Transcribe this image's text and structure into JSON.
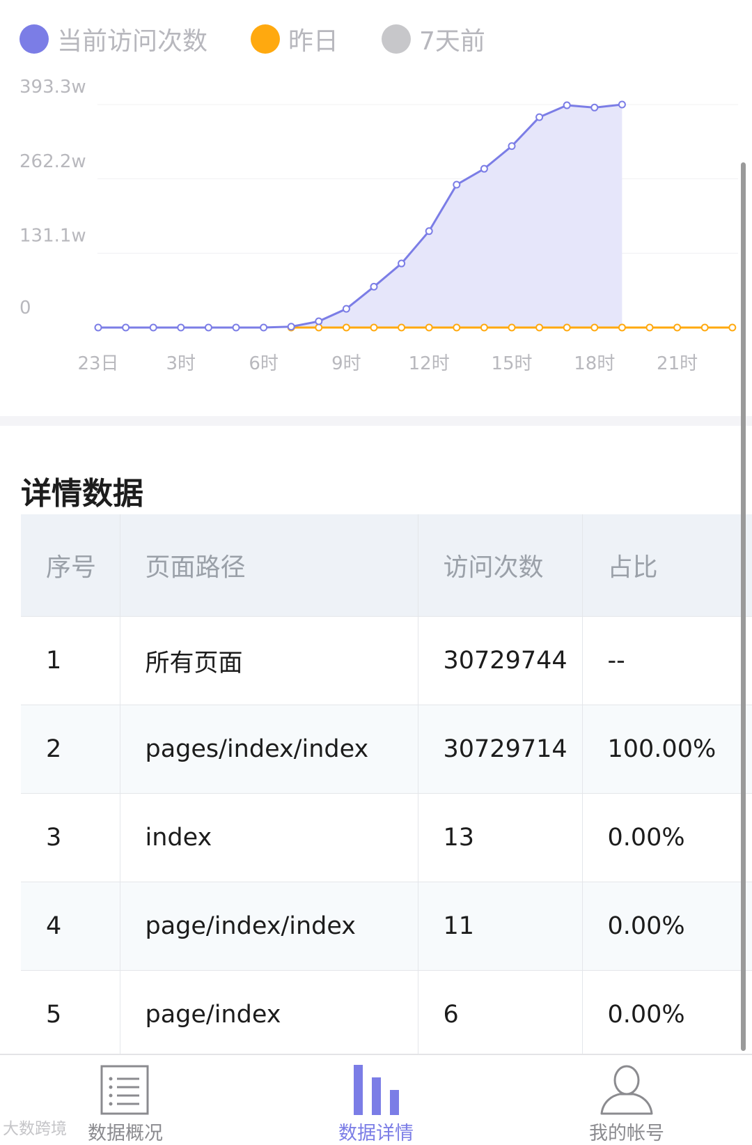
{
  "legend": [
    {
      "label": "当前访问次数",
      "color": "#7b7de6"
    },
    {
      "label": "昨日",
      "color": "#ffa90f"
    },
    {
      "label": "7天前",
      "color": "#c7c7ca"
    }
  ],
  "chart_data": {
    "type": "area",
    "x": [
      "0",
      "1",
      "2",
      "3",
      "4",
      "5",
      "6",
      "7",
      "8",
      "9",
      "10",
      "11",
      "12",
      "13",
      "14",
      "15",
      "16",
      "17",
      "18",
      "19",
      "20",
      "21",
      "22",
      "23"
    ],
    "x_tick_labels": [
      "23日",
      "3时",
      "6时",
      "9时",
      "12时",
      "15时",
      "18时",
      "21时"
    ],
    "y_tick_labels": [
      "393.3w",
      "262.2w",
      "131.1w",
      "0"
    ],
    "ylim": [
      0,
      393.3
    ],
    "series": [
      {
        "name": "当前访问次数",
        "color": "#7b7de6",
        "fill": "#e6e6fa",
        "values": [
          0,
          0,
          0,
          0,
          0,
          0,
          0,
          1.5,
          11,
          33,
          72,
          113,
          170,
          252,
          280,
          320,
          371,
          392,
          388,
          393.3,
          null,
          null,
          null,
          null
        ]
      },
      {
        "name": "昨日",
        "color": "#ffa90f",
        "values": [
          null,
          null,
          null,
          null,
          null,
          null,
          null,
          0,
          0,
          0,
          0,
          0,
          0,
          0,
          0,
          0,
          0,
          0,
          0,
          0,
          0,
          0,
          0,
          0
        ]
      }
    ],
    "grid": true
  },
  "section_title": "详情数据",
  "table": {
    "headers": [
      "序号",
      "页面路径",
      "访问次数",
      "占比"
    ],
    "rows": [
      [
        "1",
        "所有页面",
        "30729744",
        "--"
      ],
      [
        "2",
        "pages/index/index",
        "30729714",
        "100.00%"
      ],
      [
        "3",
        "index",
        "13",
        "0.00%"
      ],
      [
        "4",
        "page/index/index",
        "11",
        "0.00%"
      ],
      [
        "5",
        "page/index",
        "6",
        "0.00%"
      ]
    ]
  },
  "tabs": [
    {
      "label": "数据概况",
      "icon": "list-doc-icon",
      "active": false
    },
    {
      "label": "数据详情",
      "icon": "bar-chart-icon",
      "active": true
    },
    {
      "label": "我的帐号",
      "icon": "user-icon",
      "active": false
    }
  ],
  "watermark": "大数跨境"
}
